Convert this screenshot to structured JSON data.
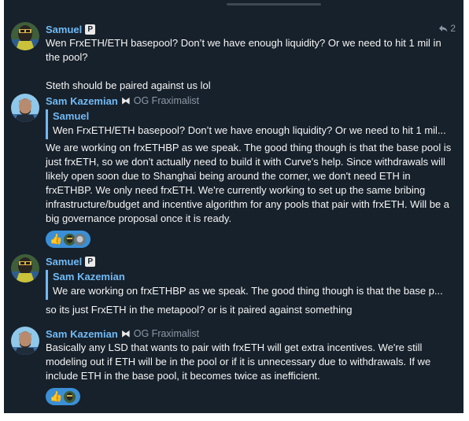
{
  "messages": [
    {
      "author": "Samuel",
      "author_badge": "P",
      "reply_count": "2",
      "text": "Wen FrxETH/ETH basepool? Don’t we have enough liquidity? Or we need to hit 1 mil in the pool?\n\nSteth should be paired against us lol"
    },
    {
      "author": "Sam Kazemian",
      "author_badge": "⧓",
      "author_title": "OG Fraximalist",
      "quote_author": "Samuel",
      "quote_text": "Wen FrxETH/ETH basepool? Don’t we have enough liquidity? Or we need to hit 1 mil...",
      "text": "We are working on frxETHBP as we speak. The good thing though is that the base pool is just frxETH, so we don't actually need to build it with Curve's help. Since withdrawals will likely open soon due to Shanghai being around the corner, we don't need ETH in frxETHBP. We only need frxETH. We're currently working to set up the same bribing infrastructure/budget and incentive algorithm for any pools that pair with frxETH. Will be a big governance proposal once it is ready.",
      "reactions": {
        "emoji": "👍"
      }
    },
    {
      "author": "Samuel",
      "author_badge": "P",
      "quote_author": "Sam Kazemian",
      "quote_text": "We are working on frxETHBP as we speak. The good thing though is that the base p...",
      "text": "so its just FrxETH in the metapool? or is it paired against something"
    },
    {
      "author": "Sam Kazemian",
      "author_badge": "⧓",
      "author_title": "OG Fraximalist",
      "text": "Basically any LSD that wants to pair with frxETH will get extra incentives. We're still modeling out if ETH will be in the pool or if it is unnecessary due to withdrawals. If we include ETH in the base pool, it becomes twice as inefficient.",
      "reactions": {
        "emoji": "👍"
      }
    }
  ],
  "colors": {
    "background": "#17212b",
    "name": "#71baf5",
    "text": "#f5f5f5",
    "muted": "#8b98a6",
    "reaction_bg": "#3a8fd6"
  },
  "icons": {
    "reply": "reply-arrow-icon",
    "reaction": "thumbs-up-icon"
  }
}
